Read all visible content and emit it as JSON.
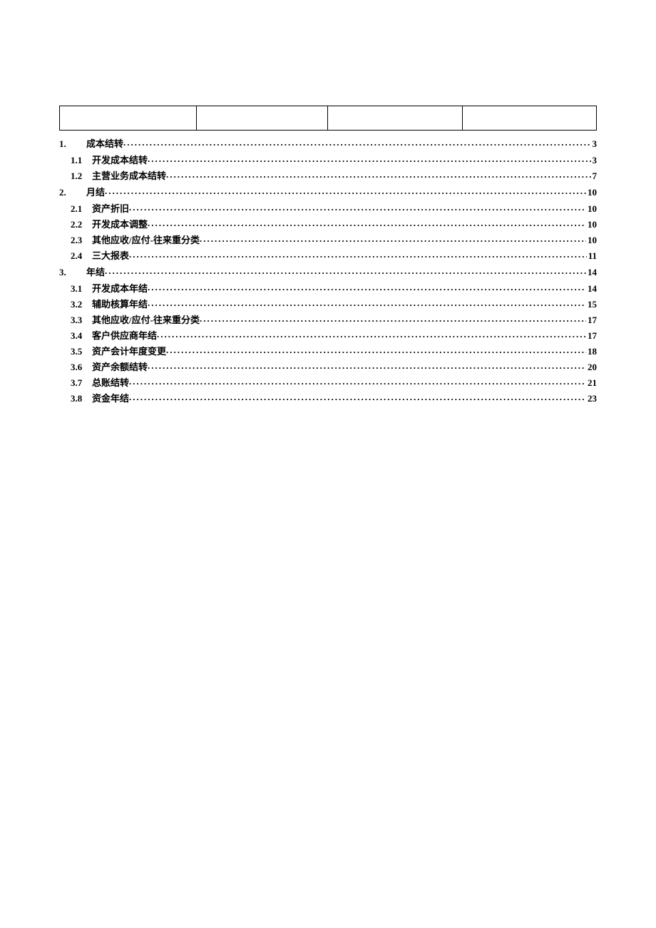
{
  "toc": [
    {
      "level": 1,
      "num": "1.",
      "title": "成本结转",
      "page": "3"
    },
    {
      "level": 2,
      "num": "1.1",
      "title": "开发成本结转",
      "page": "3"
    },
    {
      "level": 2,
      "num": "1.2",
      "title": "主营业务成本结转",
      "page": "7"
    },
    {
      "level": 1,
      "num": "2.",
      "title": "月结",
      "page": "10"
    },
    {
      "level": 2,
      "num": "2.1",
      "title": "资产折旧",
      "page": "10"
    },
    {
      "level": 2,
      "num": "2.2",
      "title": "开发成本调整",
      "page": "10"
    },
    {
      "level": 2,
      "num": "2.3",
      "title": "其他应收/应付-往来重分类",
      "page": "10"
    },
    {
      "level": 2,
      "num": "2.4",
      "title": "三大报表",
      "page": "11"
    },
    {
      "level": 1,
      "num": "3.",
      "title": "年结",
      "page": "14"
    },
    {
      "level": 2,
      "num": "3.1",
      "title": "开发成本年结",
      "page": "14"
    },
    {
      "level": 2,
      "num": "3.2",
      "title": "辅助核算年结",
      "page": "15"
    },
    {
      "level": 2,
      "num": "3.3",
      "title": "其他应收/应付-往来重分类",
      "page": "17"
    },
    {
      "level": 2,
      "num": "3.4",
      "title": "客户供应商年结",
      "page": "17"
    },
    {
      "level": 2,
      "num": "3.5",
      "title": "资产会计年度变更",
      "page": "18"
    },
    {
      "level": 2,
      "num": "3.6",
      "title": "资产余额结转",
      "page": "20"
    },
    {
      "level": 2,
      "num": "3.7",
      "title": "总账结转",
      "page": "21"
    },
    {
      "level": 2,
      "num": "3.8",
      "title": "资金年结",
      "page": "23"
    }
  ]
}
